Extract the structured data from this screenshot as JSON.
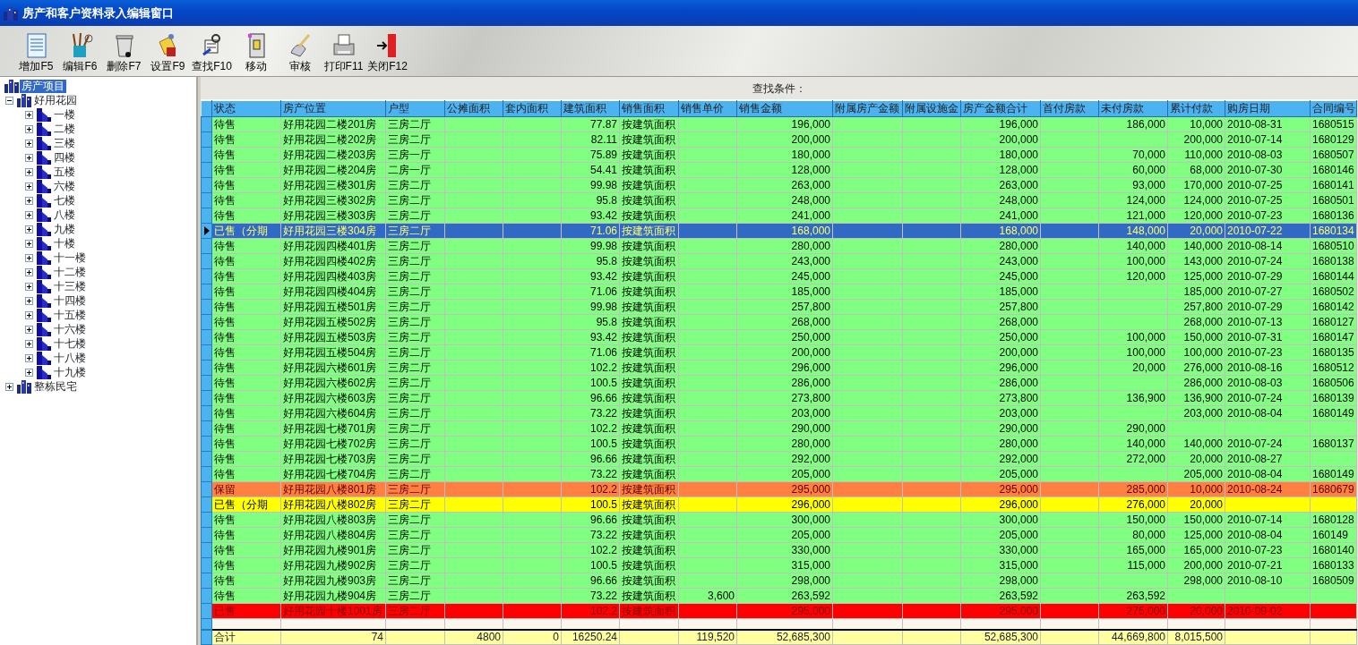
{
  "window": {
    "title": "房产和客户资料录入编辑窗口"
  },
  "toolbar": [
    {
      "label": "增加F5",
      "kind": "add"
    },
    {
      "label": "编辑F6",
      "kind": "edit"
    },
    {
      "label": "删除F7",
      "kind": "delete"
    },
    {
      "label": "设置F9",
      "kind": "settings"
    },
    {
      "label": "查找F10",
      "kind": "find"
    },
    {
      "label": "移动",
      "kind": "move"
    },
    {
      "label": "审核",
      "kind": "review"
    },
    {
      "label": "打印F11",
      "kind": "print"
    },
    {
      "label": "关闭F12",
      "kind": "close"
    }
  ],
  "tree": {
    "label": "房产项目",
    "selected": true,
    "children": [
      {
        "label": "好用花园",
        "selected": false,
        "expanded": true,
        "children": [
          {
            "label": "一楼",
            "selected": false,
            "expanded": false
          },
          {
            "label": "二楼",
            "selected": false,
            "expanded": false
          },
          {
            "label": "三楼",
            "selected": false,
            "expanded": false
          },
          {
            "label": "四楼",
            "selected": false,
            "expanded": false
          },
          {
            "label": "五楼",
            "selected": false,
            "expanded": false
          },
          {
            "label": "六楼",
            "selected": false,
            "expanded": false
          },
          {
            "label": "七楼",
            "selected": false,
            "expanded": false
          },
          {
            "label": "八楼",
            "selected": false,
            "expanded": false
          },
          {
            "label": "九楼",
            "selected": false,
            "expanded": false
          },
          {
            "label": "十楼",
            "selected": false,
            "expanded": false
          },
          {
            "label": "十一楼",
            "selected": false,
            "expanded": false
          },
          {
            "label": "十二楼",
            "selected": false,
            "expanded": false
          },
          {
            "label": "十三楼",
            "selected": false,
            "expanded": false
          },
          {
            "label": "十四楼",
            "selected": false,
            "expanded": false
          },
          {
            "label": "十五楼",
            "selected": false,
            "expanded": false
          },
          {
            "label": "十六楼",
            "selected": false,
            "expanded": false
          },
          {
            "label": "十七楼",
            "selected": false,
            "expanded": false
          },
          {
            "label": "十八楼",
            "selected": false,
            "expanded": false
          },
          {
            "label": "十九楼",
            "selected": false,
            "expanded": false
          }
        ]
      },
      {
        "label": "整栋民宅",
        "selected": false,
        "expanded": false
      }
    ]
  },
  "filter": {
    "label": "查找条件："
  },
  "table": {
    "columns": [
      "状态",
      "房产位置",
      "户型",
      "公摊面积",
      "套内面积",
      "建筑面积",
      "销售面积",
      "销售单价",
      "销售金额",
      "附属房产金额",
      "附属设施金",
      "房产金额合计",
      "首付房款",
      "未付房款",
      "累计付款",
      "购房日期",
      "合同编号"
    ],
    "rows": [
      {
        "color": "#80ff80",
        "selected": false,
        "status": "待售",
        "location": "好用花园二楼201房",
        "layout": "三房二厅",
        "building_area": "77.87",
        "sale_area": "按建筑面积",
        "sale_amount": "196,000",
        "property_total": "196,000",
        "unpaid": "186,000",
        "paid_total": "10,000",
        "purchase_date": "2010-08-31",
        "contract_no": "1680515"
      },
      {
        "color": "#80ff80",
        "selected": false,
        "status": "待售",
        "location": "好用花园二楼202房",
        "layout": "三房二厅",
        "building_area": "82.11",
        "sale_area": "按建筑面积",
        "sale_amount": "200,000",
        "property_total": "200,000",
        "paid_total": "200,000",
        "purchase_date": "2010-07-14",
        "contract_no": "1680129"
      },
      {
        "color": "#80ff80",
        "selected": false,
        "status": "待售",
        "location": "好用花园二楼203房",
        "layout": "三房一厅",
        "building_area": "75.89",
        "sale_area": "按建筑面积",
        "sale_amount": "180,000",
        "property_total": "180,000",
        "unpaid": "70,000",
        "paid_total": "110,000",
        "purchase_date": "2010-08-03",
        "contract_no": "1680507"
      },
      {
        "color": "#80ff80",
        "selected": false,
        "status": "待售",
        "location": "好用花园二楼204房",
        "layout": "二房一厅",
        "building_area": "54.41",
        "sale_area": "按建筑面积",
        "sale_amount": "128,000",
        "property_total": "128,000",
        "unpaid": "60,000",
        "paid_total": "68,000",
        "purchase_date": "2010-07-30",
        "contract_no": "1680146"
      },
      {
        "color": "#80ff80",
        "selected": false,
        "status": "待售",
        "location": "好用花园三楼301房",
        "layout": "三房二厅",
        "building_area": "99.98",
        "sale_area": "按建筑面积",
        "sale_amount": "263,000",
        "property_total": "263,000",
        "unpaid": "93,000",
        "paid_total": "170,000",
        "purchase_date": "2010-07-25",
        "contract_no": "1680141"
      },
      {
        "color": "#80ff80",
        "selected": false,
        "status": "待售",
        "location": "好用花园三楼302房",
        "layout": "三房二厅",
        "building_area": "95.8",
        "sale_area": "按建筑面积",
        "sale_amount": "248,000",
        "property_total": "248,000",
        "unpaid": "124,000",
        "paid_total": "124,000",
        "purchase_date": "2010-07-25",
        "contract_no": "1680501"
      },
      {
        "color": "#80ff80",
        "selected": false,
        "status": "待售",
        "location": "好用花园三楼303房",
        "layout": "三房二厅",
        "building_area": "93.42",
        "sale_area": "按建筑面积",
        "sale_amount": "241,000",
        "property_total": "241,000",
        "unpaid": "121,000",
        "paid_total": "120,000",
        "purchase_date": "2010-07-23",
        "contract_no": "1680136"
      },
      {
        "selected": true,
        "status": "已售（分期",
        "location": "好用花园三楼304房",
        "layout": "三房二厅",
        "building_area": "71.06",
        "sale_area": "按建筑面积",
        "sale_amount": "168,000",
        "property_total": "168,000",
        "unpaid": "148,000",
        "paid_total": "20,000",
        "purchase_date": "2010-07-22",
        "contract_no": "1680134"
      },
      {
        "color": "#80ff80",
        "selected": false,
        "status": "待售",
        "location": "好用花园四楼401房",
        "layout": "三房二厅",
        "building_area": "99.98",
        "sale_area": "按建筑面积",
        "sale_amount": "280,000",
        "property_total": "280,000",
        "unpaid": "140,000",
        "paid_total": "140,000",
        "purchase_date": "2010-08-14",
        "contract_no": "1680510"
      },
      {
        "color": "#80ff80",
        "selected": false,
        "status": "待售",
        "location": "好用花园四楼402房",
        "layout": "三房二厅",
        "building_area": "95.8",
        "sale_area": "按建筑面积",
        "sale_amount": "243,000",
        "property_total": "243,000",
        "unpaid": "100,000",
        "paid_total": "143,000",
        "purchase_date": "2010-07-24",
        "contract_no": "1680138"
      },
      {
        "color": "#80ff80",
        "selected": false,
        "status": "待售",
        "location": "好用花园四楼403房",
        "layout": "三房二厅",
        "building_area": "93.42",
        "sale_area": "按建筑面积",
        "sale_amount": "245,000",
        "property_total": "245,000",
        "unpaid": "120,000",
        "paid_total": "125,000",
        "purchase_date": "2010-07-29",
        "contract_no": "1680144"
      },
      {
        "color": "#80ff80",
        "selected": false,
        "status": "待售",
        "location": "好用花园四楼404房",
        "layout": "三房二厅",
        "building_area": "71.06",
        "sale_area": "按建筑面积",
        "sale_amount": "185,000",
        "property_total": "185,000",
        "paid_total": "185,000",
        "purchase_date": "2010-07-27",
        "contract_no": "1680502"
      },
      {
        "color": "#80ff80",
        "selected": false,
        "status": "待售",
        "location": "好用花园五楼501房",
        "layout": "三房二厅",
        "building_area": "99.98",
        "sale_area": "按建筑面积",
        "sale_amount": "257,800",
        "property_total": "257,800",
        "paid_total": "257,800",
        "purchase_date": "2010-07-29",
        "contract_no": "1680142"
      },
      {
        "color": "#80ff80",
        "selected": false,
        "status": "待售",
        "location": "好用花园五楼502房",
        "layout": "三房二厅",
        "building_area": "95.8",
        "sale_area": "按建筑面积",
        "sale_amount": "268,000",
        "property_total": "268,000",
        "paid_total": "268,000",
        "purchase_date": "2010-07-13",
        "contract_no": "1680127"
      },
      {
        "color": "#80ff80",
        "selected": false,
        "status": "待售",
        "location": "好用花园五楼503房",
        "layout": "三房二厅",
        "building_area": "93.42",
        "sale_area": "按建筑面积",
        "sale_amount": "250,000",
        "property_total": "250,000",
        "unpaid": "100,000",
        "paid_total": "150,000",
        "purchase_date": "2010-07-31",
        "contract_no": "1680147"
      },
      {
        "color": "#80ff80",
        "selected": false,
        "status": "待售",
        "location": "好用花园五楼504房",
        "layout": "三房二厅",
        "building_area": "71.06",
        "sale_area": "按建筑面积",
        "sale_amount": "200,000",
        "property_total": "200,000",
        "unpaid": "100,000",
        "paid_total": "100,000",
        "purchase_date": "2010-07-23",
        "contract_no": "1680135"
      },
      {
        "color": "#80ff80",
        "selected": false,
        "status": "待售",
        "location": "好用花园六楼601房",
        "layout": "三房二厅",
        "building_area": "102.2",
        "sale_area": "按建筑面积",
        "sale_amount": "296,000",
        "property_total": "296,000",
        "unpaid": "20,000",
        "paid_total": "276,000",
        "purchase_date": "2010-08-16",
        "contract_no": "1680512"
      },
      {
        "color": "#80ff80",
        "selected": false,
        "status": "待售",
        "location": "好用花园六楼602房",
        "layout": "三房二厅",
        "building_area": "100.5",
        "sale_area": "按建筑面积",
        "sale_amount": "286,000",
        "property_total": "286,000",
        "paid_total": "286,000",
        "purchase_date": "2010-08-03",
        "contract_no": "1680506"
      },
      {
        "color": "#80ff80",
        "selected": false,
        "status": "待售",
        "location": "好用花园六楼603房",
        "layout": "三房二厅",
        "building_area": "96.66",
        "sale_area": "按建筑面积",
        "sale_amount": "273,800",
        "property_total": "273,800",
        "unpaid": "136,900",
        "paid_total": "136,900",
        "purchase_date": "2010-07-24",
        "contract_no": "1680139"
      },
      {
        "color": "#80ff80",
        "selected": false,
        "status": "待售",
        "location": "好用花园六楼604房",
        "layout": "三房二厅",
        "building_area": "73.22",
        "sale_area": "按建筑面积",
        "sale_amount": "203,000",
        "property_total": "203,000",
        "paid_total": "203,000",
        "purchase_date": "2010-08-04",
        "contract_no": "1680149"
      },
      {
        "color": "#80ff80",
        "selected": false,
        "status": "待售",
        "location": "好用花园七楼701房",
        "layout": "三房二厅",
        "building_area": "102.2",
        "sale_area": "按建筑面积",
        "sale_amount": "290,000",
        "property_total": "290,000",
        "unpaid": "290,000"
      },
      {
        "color": "#80ff80",
        "selected": false,
        "status": "待售",
        "location": "好用花园七楼702房",
        "layout": "三房二厅",
        "building_area": "100.5",
        "sale_area": "按建筑面积",
        "sale_amount": "280,000",
        "property_total": "280,000",
        "unpaid": "140,000",
        "paid_total": "140,000",
        "purchase_date": "2010-07-24",
        "contract_no": "1680137"
      },
      {
        "color": "#80ff80",
        "selected": false,
        "status": "待售",
        "location": "好用花园七楼703房",
        "layout": "三房二厅",
        "building_area": "96.66",
        "sale_area": "按建筑面积",
        "sale_amount": "292,000",
        "property_total": "292,000",
        "unpaid": "272,000",
        "paid_total": "20,000",
        "purchase_date": "2010-08-27"
      },
      {
        "color": "#80ff80",
        "selected": false,
        "status": "待售",
        "location": "好用花园七楼704房",
        "layout": "三房二厅",
        "building_area": "73.22",
        "sale_area": "按建筑面积",
        "sale_amount": "205,000",
        "property_total": "205,000",
        "paid_total": "205,000",
        "purchase_date": "2010-08-04",
        "contract_no": "1680149"
      },
      {
        "color": "#ff8040",
        "selected": false,
        "status": "保留",
        "location": "好用花园八楼801房",
        "layout": "三房二厅",
        "building_area": "102.2",
        "sale_area": "按建筑面积",
        "sale_amount": "295,000",
        "property_total": "295,000",
        "unpaid": "285,000",
        "paid_total": "10,000",
        "purchase_date": "2010-08-24",
        "contract_no": "1680679"
      },
      {
        "color": "#ffff00",
        "selected": false,
        "status": "已售（分期",
        "location": "好用花园八楼802房",
        "layout": "三房二厅",
        "building_area": "100.5",
        "sale_area": "按建筑面积",
        "sale_amount": "296,000",
        "property_total": "296,000",
        "unpaid": "276,000",
        "paid_total": "20,000"
      },
      {
        "color": "#80ff80",
        "selected": false,
        "status": "待售",
        "location": "好用花园八楼803房",
        "layout": "三房二厅",
        "building_area": "96.66",
        "sale_area": "按建筑面积",
        "sale_amount": "300,000",
        "property_total": "300,000",
        "unpaid": "150,000",
        "paid_total": "150,000",
        "purchase_date": "2010-07-14",
        "contract_no": "1680128"
      },
      {
        "color": "#80ff80",
        "selected": false,
        "status": "待售",
        "location": "好用花园八楼804房",
        "layout": "三房二厅",
        "building_area": "73.22",
        "sale_area": "按建筑面积",
        "sale_amount": "205,000",
        "property_total": "205,000",
        "unpaid": "80,000",
        "paid_total": "125,000",
        "purchase_date": "2010-08-04",
        "contract_no": "160149"
      },
      {
        "color": "#80ff80",
        "selected": false,
        "status": "待售",
        "location": "好用花园九楼901房",
        "layout": "三房二厅",
        "building_area": "102.2",
        "sale_area": "按建筑面积",
        "sale_amount": "330,000",
        "property_total": "330,000",
        "unpaid": "165,000",
        "paid_total": "165,000",
        "purchase_date": "2010-07-23",
        "contract_no": "1680140"
      },
      {
        "color": "#80ff80",
        "selected": false,
        "status": "待售",
        "location": "好用花园九楼902房",
        "layout": "三房二厅",
        "building_area": "100.5",
        "sale_area": "按建筑面积",
        "sale_amount": "315,000",
        "property_total": "315,000",
        "unpaid": "115,000",
        "paid_total": "200,000",
        "purchase_date": "2010-07-21",
        "contract_no": "1680133"
      },
      {
        "color": "#80ff80",
        "selected": false,
        "status": "待售",
        "location": "好用花园九楼903房",
        "layout": "三房二厅",
        "building_area": "96.66",
        "sale_area": "按建筑面积",
        "sale_amount": "298,000",
        "property_total": "298,000",
        "paid_total": "298,000",
        "purchase_date": "2010-08-10",
        "contract_no": "1680509"
      },
      {
        "color": "#80ff80",
        "selected": false,
        "status": "待售",
        "location": "好用花园九楼904房",
        "layout": "三房二厅",
        "building_area": "73.22",
        "sale_area": "按建筑面积",
        "unit_price": "3,600",
        "sale_amount": "263,592",
        "property_total": "263,592",
        "unpaid": "263,592"
      },
      {
        "color": "#ff0000",
        "selected": false,
        "status": "已售",
        "location": "好用花园十楼1001房",
        "layout": "三房二厅",
        "building_area": "102.2",
        "sale_area": "按建筑面积",
        "sale_amount": "295,000",
        "property_total": "295,000",
        "unpaid": "275,000",
        "paid_total": "20,000",
        "purchase_date": "2010-09-02"
      }
    ],
    "totals": {
      "status": "合计",
      "location": "74",
      "shared_area": "4800",
      "inner_area": "0",
      "building_area": "16250.24",
      "unit_price": "119,520",
      "sale_amount": "52,685,300",
      "property_total": "52,685,300",
      "unpaid": "44,669,800",
      "paid_total": "8,015,500"
    }
  }
}
